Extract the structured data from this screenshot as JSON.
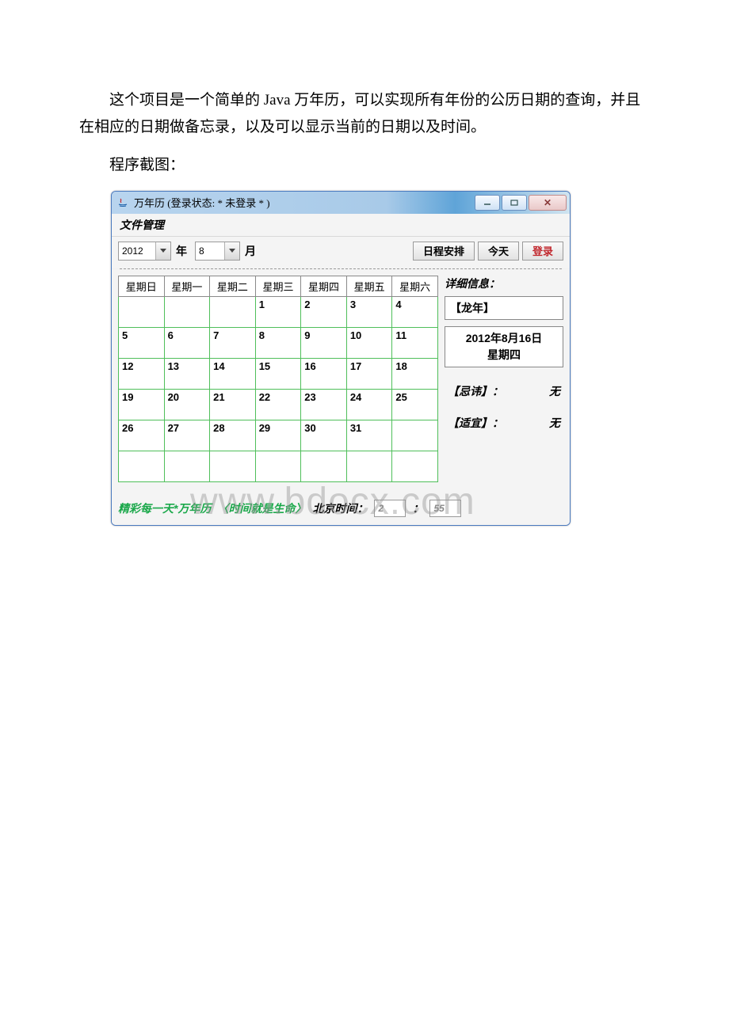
{
  "doc": {
    "para1": "这个项目是一个简单的 Java 万年历，可以实现所有年份的公历日期的查询，并且在相应的日期做备忘录，以及可以显示当前的日期以及时间。",
    "para2": "程序截图："
  },
  "window": {
    "title": "万年历      (登录状态: * 未登录 * )",
    "menubar": "文件管理",
    "year": "2012",
    "year_label": "年",
    "month": "8",
    "month_label": "月",
    "schedule_btn": "日程安排",
    "today_btn": "今天",
    "login_btn": "登录",
    "weekday_headers": [
      "星期日",
      "星期一",
      "星期二",
      "星期三",
      "星期四",
      "星期五",
      "星期六"
    ],
    "calendar_rows": [
      [
        "",
        "",
        "",
        "1",
        "2",
        "3",
        "4"
      ],
      [
        "5",
        "6",
        "7",
        "8",
        "9",
        "10",
        "11"
      ],
      [
        "12",
        "13",
        "14",
        "15",
        "16",
        "17",
        "18"
      ],
      [
        "19",
        "20",
        "21",
        "22",
        "23",
        "24",
        "25"
      ],
      [
        "26",
        "27",
        "28",
        "29",
        "30",
        "31",
        ""
      ],
      [
        "",
        "",
        "",
        "",
        "",
        "",
        ""
      ]
    ],
    "side": {
      "detail_label": "详细信息：",
      "zodiac": "【龙年】",
      "date_line1": "2012年8月16日",
      "date_line2": "星期四",
      "taboo_label": "【忌讳】：",
      "taboo_value": "无",
      "suit_label": "【适宜】：",
      "suit_value": "无"
    },
    "footer": {
      "motto": "精彩每一天*万年历",
      "sub": "〈时间就是生命〉",
      "bj_label": "北京时间：",
      "hour": "2",
      "colon": "：",
      "minute": "55"
    }
  },
  "watermark": "www.bdocx.com"
}
